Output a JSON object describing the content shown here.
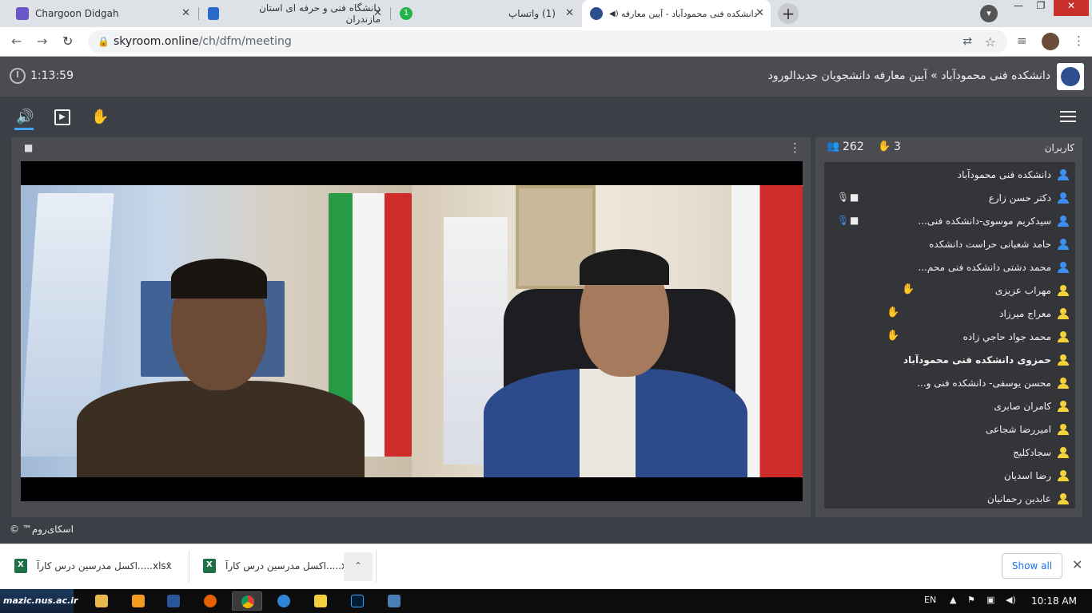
{
  "browser": {
    "tabs": [
      {
        "title": "Chargoon Didgah",
        "close": "✕"
      },
      {
        "title": "دانشگاه فنی و حرفه ای استان مازندران",
        "close": "✕"
      },
      {
        "title": "(1) واتساپ",
        "badge": "1",
        "close": "✕"
      },
      {
        "title": "دانشکده فنی محمودآباد - آیین معارفه د",
        "close": "✕"
      }
    ],
    "new_tab": "+",
    "window_controls": {
      "minimize": "—",
      "restore": "❐",
      "close": "✕"
    },
    "nav": {
      "back": "←",
      "forward": "→",
      "reload": "↻"
    },
    "url_host": "skyroom.online",
    "url_path": "/ch/dfm/meeting",
    "lock": "🔒",
    "icons": {
      "translate": "⇄",
      "star": "☆",
      "media": "≡",
      "more": "⋮"
    }
  },
  "meeting": {
    "timer": "1:13:59",
    "title": "دانشکده فنی محمودآباد » آیین معارفه دانشجویان جدیدالورود",
    "toolbar": {
      "audio": "🔊",
      "video": "▶",
      "hand": "✋",
      "menu": ""
    },
    "video_panel": {
      "cam_icon": "■",
      "options": "⋮"
    },
    "users": {
      "label": "کاربران",
      "count": "262",
      "hands": "3",
      "list": [
        {
          "name": "دانشکده فنی محمودآباد",
          "color": "blue"
        },
        {
          "name": "دکتر حسن زارع",
          "color": "blue",
          "mic": true,
          "mic_color": "#dddddd",
          "cam": true
        },
        {
          "name": "سیدکریم موسوی-دانشکده فنی...",
          "color": "blue",
          "mic": true,
          "mic_color": "#3d8ef0",
          "cam": true
        },
        {
          "name": "حامد شعبانی حراست دانشکده",
          "color": "blue"
        },
        {
          "name": "محمد دشتی دانشکده فنی محم...",
          "color": "blue"
        },
        {
          "name": "مهراب عزیزی",
          "color": "yellow",
          "hand": true
        },
        {
          "name": "معراج میرزاد",
          "color": "yellow",
          "hand": true
        },
        {
          "name": "محمد جواد حاجي زاده",
          "color": "yellow",
          "hand": true
        },
        {
          "name": "حمزوی دانشکده فنی محمودآباد",
          "color": "yellow",
          "bold": true
        },
        {
          "name": "محسن یوسفی- دانشکده فنی و...",
          "color": "yellow"
        },
        {
          "name": "کامران صابری",
          "color": "yellow"
        },
        {
          "name": "امیررضا شجاعی",
          "color": "yellow"
        },
        {
          "name": "سجادکلیج",
          "color": "yellow"
        },
        {
          "name": "رضا اسدیان",
          "color": "yellow"
        },
        {
          "name": "عابدین رحمانیان",
          "color": "yellow"
        }
      ]
    },
    "footer": "اسکای‌روم™ ©"
  },
  "downloads": {
    "items": [
      {
        "name": "اکسل مدرسین درس کارآ.....xlsx",
        "chevron": "⌃"
      },
      {
        "name": "اکسل مدرسین درس کارآ.....xlsx",
        "chevron": "⌃"
      }
    ],
    "show_all": "Show all",
    "close": "✕"
  },
  "taskbar": {
    "start_label": "mazic.nus.ac.ir",
    "lang": "EN",
    "time": "10:18 AM"
  }
}
